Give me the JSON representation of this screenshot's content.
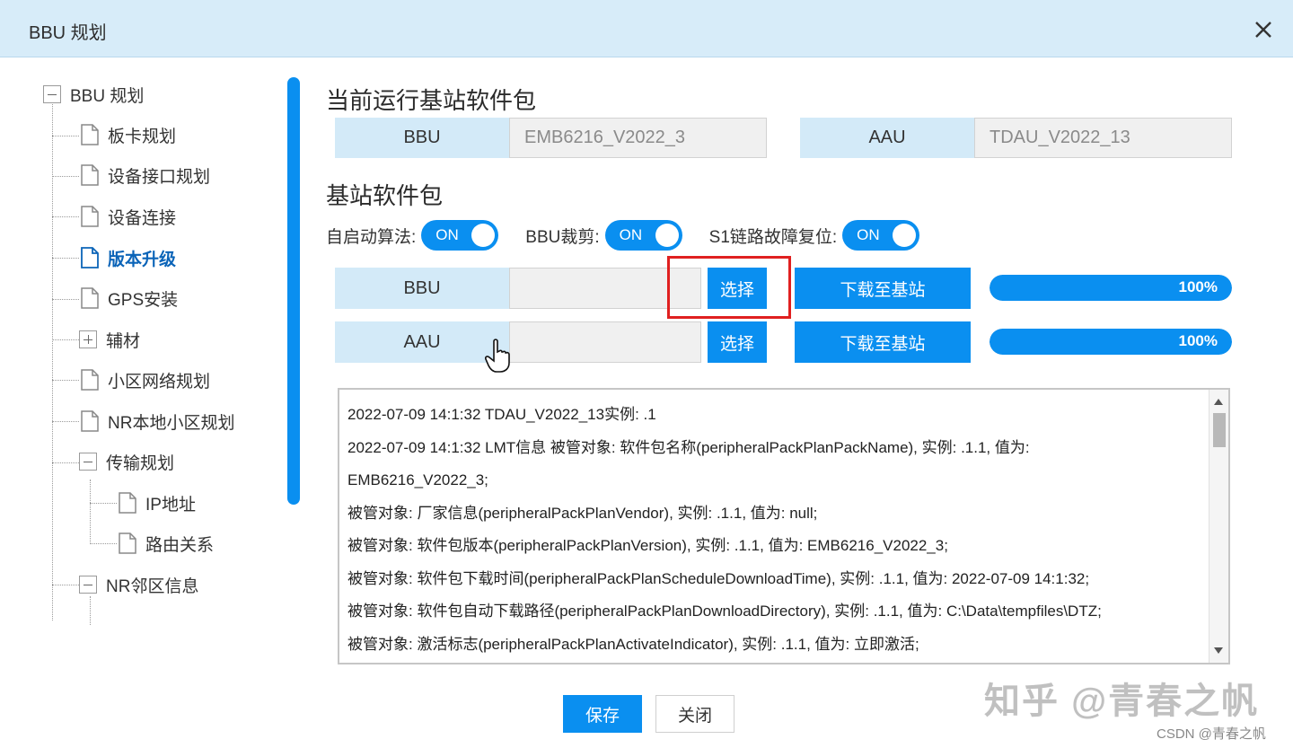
{
  "window": {
    "title": "BBU 规划"
  },
  "sidebar": {
    "items": [
      {
        "label": "BBU 规划",
        "icon": "minus-box-icon"
      },
      {
        "label": "板卡规划",
        "icon": "document-icon"
      },
      {
        "label": "设备接口规划",
        "icon": "document-icon"
      },
      {
        "label": "设备连接",
        "icon": "document-icon"
      },
      {
        "label": "版本升级",
        "icon": "document-icon",
        "active": true
      },
      {
        "label": "GPS安装",
        "icon": "document-icon"
      },
      {
        "label": "辅材",
        "icon": "plus-box-icon"
      },
      {
        "label": "小区网络规划",
        "icon": "document-icon"
      },
      {
        "label": "NR本地小区规划",
        "icon": "document-icon"
      },
      {
        "label": "传输规划",
        "icon": "minus-box-icon"
      },
      {
        "label": "IP地址",
        "icon": "document-icon"
      },
      {
        "label": "路由关系",
        "icon": "document-icon"
      },
      {
        "label": "NR邻区信息",
        "icon": "minus-box-icon"
      }
    ]
  },
  "current_pkg": {
    "heading": "当前运行基站软件包",
    "bbu_label": "BBU",
    "bbu_value": "EMB6216_V2022_3",
    "aau_label": "AAU",
    "aau_value": "TDAU_V2022_13"
  },
  "station_pkg": {
    "heading": "基站软件包",
    "toggles": [
      {
        "label": "自启动算法:",
        "state": "ON"
      },
      {
        "label": "BBU裁剪:",
        "state": "ON"
      },
      {
        "label": "S1链路故障复位:",
        "state": "ON"
      }
    ],
    "rows": [
      {
        "label": "BBU",
        "select_label": "选择",
        "download_label": "下载至基站",
        "progress_text": "100%",
        "progress": 1.0
      },
      {
        "label": "AAU",
        "select_label": "选择",
        "download_label": "下载至基站",
        "progress_text": "100%",
        "progress": 1.0
      }
    ]
  },
  "log": {
    "lines": [
      "2022-07-09 14:1:32 TDAU_V2022_13实例: .1",
      "2022-07-09 14:1:32 LMT信息 被管对象: 软件包名称(peripheralPackPlanPackName), 实例: .1.1, 值为:",
      "EMB6216_V2022_3;",
      "被管对象: 厂家信息(peripheralPackPlanVendor), 实例: .1.1, 值为: null;",
      "被管对象: 软件包版本(peripheralPackPlanVersion), 实例: .1.1, 值为: EMB6216_V2022_3;",
      "被管对象: 软件包下载时间(peripheralPackPlanScheduleDownloadTime), 实例: .1.1, 值为: 2022-07-09 14:1:32;",
      "被管对象: 软件包自动下载路径(peripheralPackPlanDownloadDirectory), 实例: .1.1, 值为: C:\\Data\\tempfiles\\DTZ;",
      "被管对象: 激活标志(peripheralPackPlanActivateIndicator), 实例: .1.1, 值为: 立即激活;"
    ]
  },
  "footer": {
    "save_label": "保存",
    "close_label": "关闭"
  },
  "watermarks": {
    "zhihu": "知乎 @青春之帆",
    "csdn": "CSDN @青春之帆"
  },
  "colors": {
    "accent": "#0a8ff0",
    "titlebar": "#d7ecf9",
    "highlight": "#e02020",
    "active_tree": "#0b64b8"
  }
}
